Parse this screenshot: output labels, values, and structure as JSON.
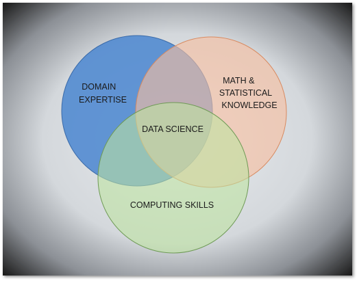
{
  "diagram": {
    "circles": [
      {
        "id": "domain-expertise",
        "label_lines": [
          "DOMAIN",
          "EXPERTISE"
        ],
        "fill": "#4a86d0",
        "stroke": "#3a6aa8"
      },
      {
        "id": "math-statistical-knowledge",
        "label_lines": [
          "MATH &",
          "STATISTICAL",
          "KNOWLEDGE"
        ],
        "fill": "#f7bfa0",
        "stroke": "#d88a60"
      },
      {
        "id": "computing-skills",
        "label_lines": [
          "COMPUTING SKILLS"
        ],
        "fill": "#bde3a0",
        "stroke": "#6e9a55"
      }
    ],
    "center_label": "DATA SCIENCE",
    "colors": {
      "background_center": "#e6e9ec",
      "background_edge": "#2a2a2a"
    }
  }
}
